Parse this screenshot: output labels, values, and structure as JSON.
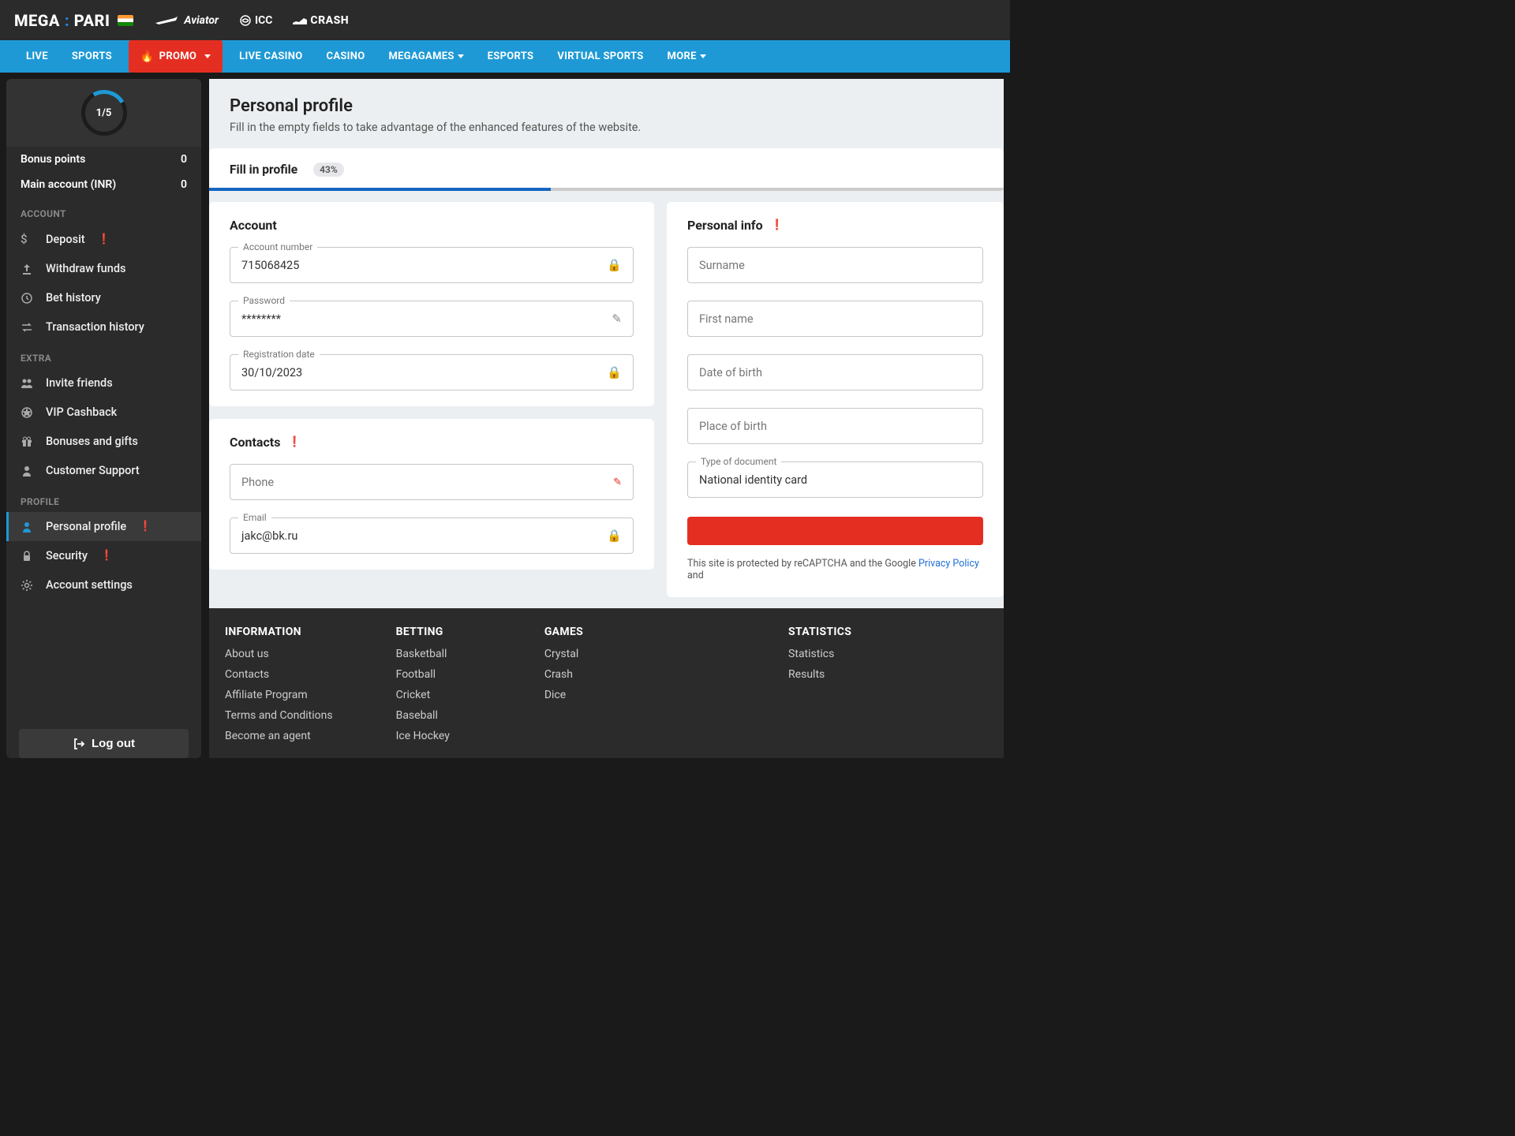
{
  "brand": {
    "name1": "MEGA",
    "name2": "PARI"
  },
  "topLinks": {
    "aviator": "Aviator",
    "icc": "ICC",
    "crash": "CRASH"
  },
  "nav": [
    "LIVE",
    "SPORTS",
    "PROMO",
    "LIVE CASINO",
    "CASINO",
    "MEGAGAMES",
    "ESPORTS",
    "VIRTUAL SPORTS",
    "MORE"
  ],
  "progress": {
    "step": "1/5",
    "pct": "43%"
  },
  "balances": {
    "bonusLabel": "Bonus points",
    "bonusVal": "0",
    "mainLabel": "Main account (INR)",
    "mainVal": "0"
  },
  "sections": {
    "account": "ACCOUNT",
    "extra": "EXTRA",
    "profile": "PROFILE"
  },
  "menu": {
    "deposit": "Deposit",
    "withdraw": "Withdraw funds",
    "bethist": "Bet history",
    "txhist": "Transaction history",
    "invite": "Invite friends",
    "vip": "VIP Cashback",
    "bonuses": "Bonuses and gifts",
    "support": "Customer Support",
    "profile": "Personal profile",
    "security": "Security",
    "settings": "Account settings"
  },
  "logout": "Log out",
  "page": {
    "title": "Personal profile",
    "sub": "Fill in the empty fields to take advantage of the enhanced features of the website."
  },
  "fillCard": {
    "title": "Fill in profile"
  },
  "accountCard": {
    "title": "Account",
    "accNumLabel": "Account number",
    "accNum": "715068425",
    "passLabel": "Password",
    "pass": "********",
    "regLabel": "Registration date",
    "reg": "30/10/2023"
  },
  "contactsCard": {
    "title": "Contacts",
    "phoneLabel": "Phone",
    "emailLabel": "Email",
    "email": "jakc@bk.ru"
  },
  "personalCard": {
    "title": "Personal info",
    "surname": "Surname",
    "first": "First name",
    "dob": "Date of birth",
    "pob": "Place of birth",
    "docLabel": "Type of document",
    "doc": "National identity card"
  },
  "recaptcha": {
    "t1": "This site is protected by reCAPTCHA and the Google ",
    "pp": "Privacy Policy",
    "t2": " and"
  },
  "footer": {
    "info": {
      "head": "INFORMATION",
      "links": [
        "About us",
        "Contacts",
        "Affiliate Program",
        "Terms and Conditions",
        "Become an agent"
      ]
    },
    "betting": {
      "head": "BETTING",
      "links": [
        "Basketball",
        "Football",
        "Cricket",
        "Baseball",
        "Ice Hockey"
      ]
    },
    "games": {
      "head": "GAMES",
      "links": [
        "Crystal",
        "Crash",
        "Dice"
      ]
    },
    "stats": {
      "head": "STATISTICS",
      "links": [
        "Statistics",
        "Results"
      ]
    }
  }
}
